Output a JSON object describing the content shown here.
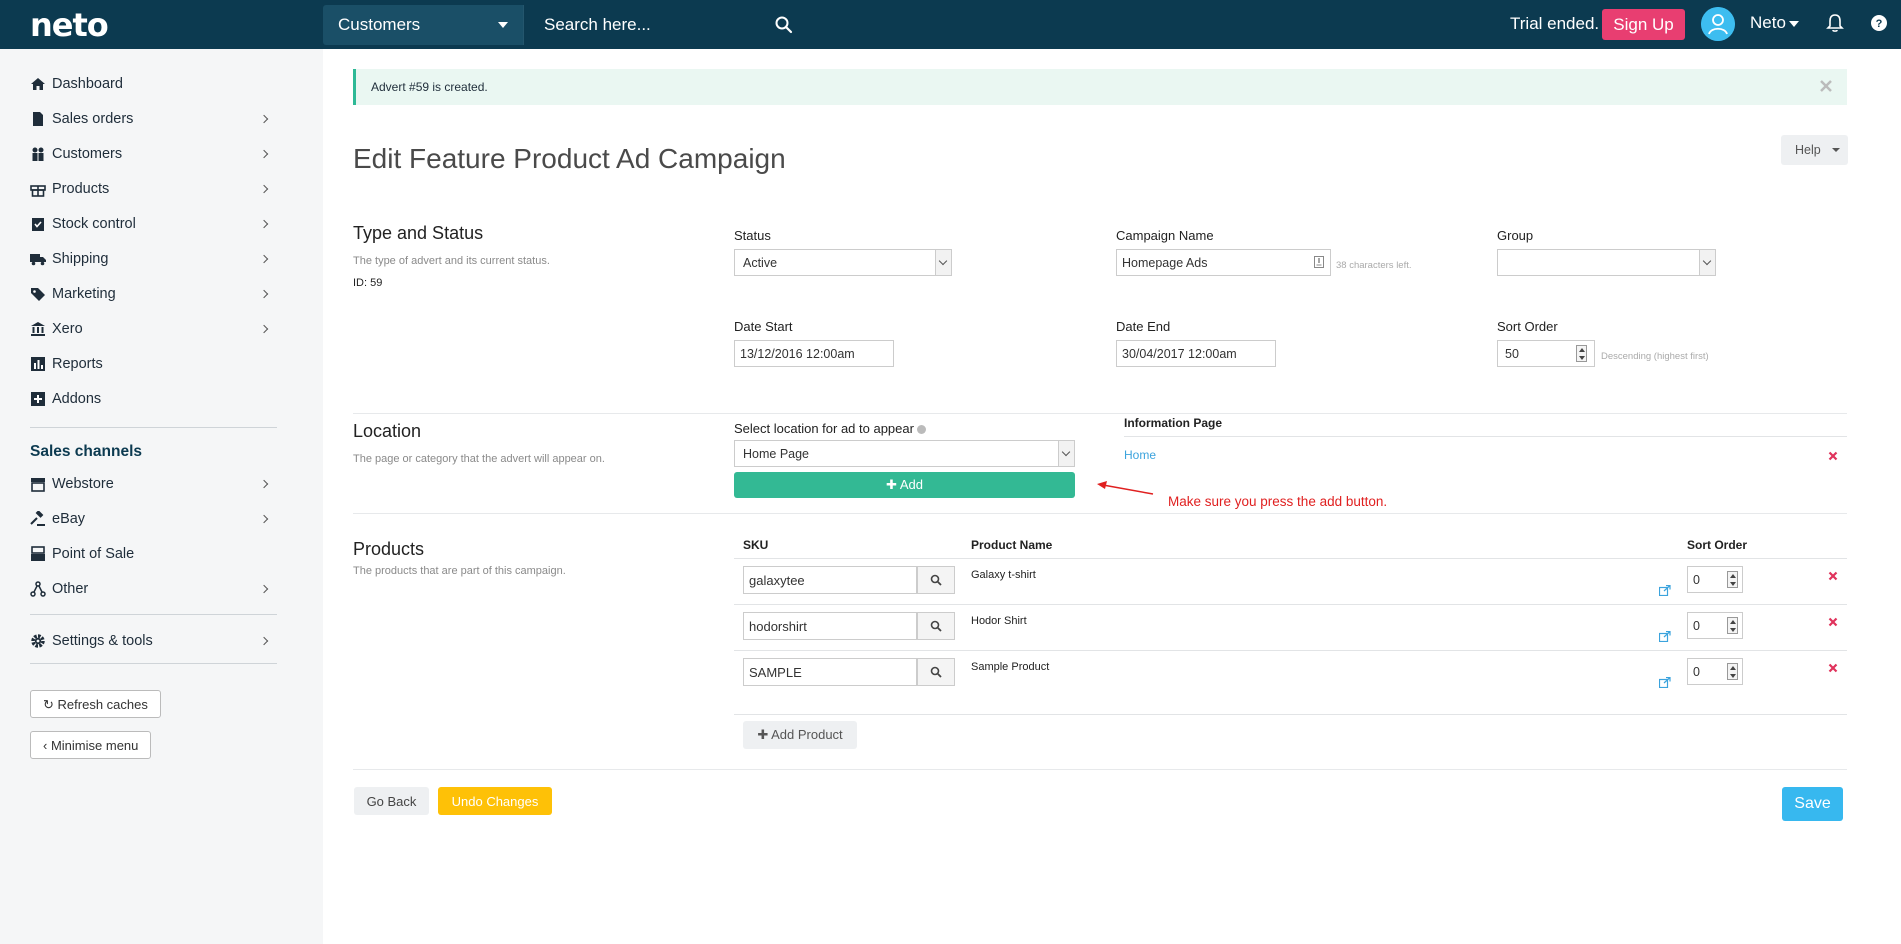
{
  "brand": {
    "logo": "neto"
  },
  "header": {
    "search_scope": "Customers",
    "search_placeholder": "Search here...",
    "trial_text": "Trial ended.",
    "signup_label": "Sign Up",
    "user_name": "Neto",
    "colors": {
      "bar": "#0c3a50",
      "signup": "#e83e71",
      "avatar": "#3dbdf0"
    }
  },
  "sidebar": {
    "items": [
      {
        "label": "Dashboard",
        "icon": "home-icon"
      },
      {
        "label": "Sales orders",
        "icon": "file-icon"
      },
      {
        "label": "Customers",
        "icon": "users-icon"
      },
      {
        "label": "Products",
        "icon": "gift-icon"
      },
      {
        "label": "Stock control",
        "icon": "clipboard-check-icon"
      },
      {
        "label": "Shipping",
        "icon": "truck-icon"
      },
      {
        "label": "Marketing",
        "icon": "tag-icon"
      },
      {
        "label": "Xero",
        "icon": "bank-icon"
      },
      {
        "label": "Reports",
        "icon": "bar-chart-icon"
      },
      {
        "label": "Addons",
        "icon": "plus-square-icon"
      }
    ],
    "channels_heading": "Sales channels",
    "channels": [
      {
        "label": "Webstore",
        "icon": "storefront-icon"
      },
      {
        "label": "eBay",
        "icon": "gavel-icon"
      },
      {
        "label": "Point of Sale",
        "icon": "register-icon"
      },
      {
        "label": "Other",
        "icon": "share-nodes-icon"
      }
    ],
    "settings": {
      "label": "Settings & tools",
      "icon": "gear-icon"
    },
    "refresh_label": "Refresh caches",
    "minimise_label": "Minimise menu"
  },
  "alert": {
    "message": "Advert #59 is created.",
    "color": "#2eb996"
  },
  "page": {
    "title": "Edit Feature Product Ad Campaign",
    "help_label": "Help"
  },
  "type_status": {
    "title": "Type and Status",
    "description": "The type of advert and its current status.",
    "id_text": "ID: 59",
    "status_label": "Status",
    "status_value": "Active",
    "campaign_label": "Campaign Name",
    "campaign_value": "Homepage Ads",
    "campaign_hint": "38 characters left.",
    "group_label": "Group",
    "group_value": "",
    "date_start_label": "Date Start",
    "date_start_value": "13/12/2016 12:00am",
    "date_end_label": "Date End",
    "date_end_value": "30/04/2017 12:00am",
    "sort_label": "Sort Order",
    "sort_value": "50",
    "sort_hint": "Descending (highest first)"
  },
  "location": {
    "title": "Location",
    "description": "The page or category that the advert will appear on.",
    "select_label": "Select location for ad to appear",
    "select_value": "Home Page",
    "add_label": "Add",
    "table_heading": "Information Page",
    "entries": [
      "Home"
    ],
    "annotation": "Make sure you press the add button."
  },
  "products": {
    "title": "Products",
    "description": "The products that are part of this campaign.",
    "columns": {
      "sku": "SKU",
      "name": "Product Name",
      "sort": "Sort Order"
    },
    "rows": [
      {
        "sku": "galaxytee",
        "name": "Galaxy t-shirt",
        "sort": "0"
      },
      {
        "sku": "hodorshirt",
        "name": "Hodor Shirt",
        "sort": "0"
      },
      {
        "sku": "SAMPLE",
        "name": "Sample Product",
        "sort": "0"
      }
    ],
    "add_label": "Add Product"
  },
  "footer": {
    "go_back": "Go Back",
    "undo": "Undo Changes",
    "save": "Save",
    "colors": {
      "undo": "#fec107",
      "save": "#37b8ef",
      "add": "#33b994"
    }
  }
}
